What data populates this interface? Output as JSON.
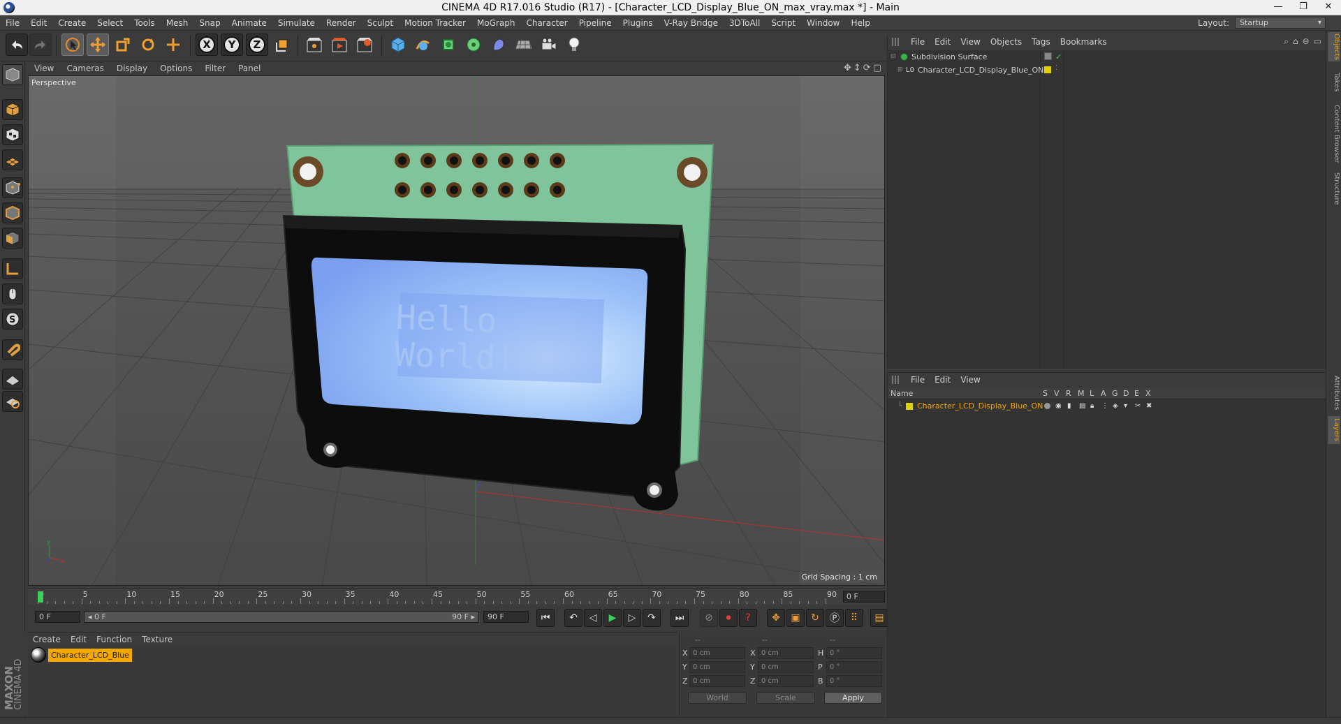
{
  "window": {
    "title": "CINEMA 4D R17.016 Studio (R17) - [Character_LCD_Display_Blue_ON_max_vray.max *] - Main",
    "controls": [
      "—",
      "❐",
      "✕"
    ]
  },
  "menubar": [
    "File",
    "Edit",
    "Create",
    "Select",
    "Tools",
    "Mesh",
    "Snap",
    "Animate",
    "Simulate",
    "Render",
    "Sculpt",
    "Motion Tracker",
    "MoGraph",
    "Character",
    "Pipeline",
    "Plugins",
    "V-Ray Bridge",
    "3DToAll",
    "Script",
    "Window",
    "Help"
  ],
  "layout": {
    "label": "Layout:",
    "value": "Startup"
  },
  "viewport": {
    "menu": [
      "View",
      "Cameras",
      "Display",
      "Options",
      "Filter",
      "Panel"
    ],
    "camera_label": "Perspective",
    "grid_spacing": "Grid Spacing : 1 cm",
    "lcd_text_line1": "Hello",
    "lcd_text_line2": "World!",
    "axis_y": "y",
    "axis_x": "x"
  },
  "timeline": {
    "ticks": [
      "0",
      "5",
      "10",
      "15",
      "20",
      "25",
      "30",
      "35",
      "40",
      "45",
      "50",
      "55",
      "60",
      "65",
      "70",
      "75",
      "80",
      "85",
      "90"
    ],
    "current_frame": "0 F",
    "start_frame": "0 F",
    "range_start": "◂ 0 F",
    "range_end": "90 F ▸",
    "end_frame": "90 F"
  },
  "material_manager": {
    "menu": [
      "Create",
      "Edit",
      "Function",
      "Texture"
    ],
    "materials": [
      "Character_LCD_Blue"
    ]
  },
  "coordinates": {
    "header": [
      "--",
      "--",
      "--"
    ],
    "rows": [
      {
        "a": "X",
        "av": "0 cm",
        "b": "X",
        "bv": "0 cm",
        "c": "H",
        "cv": "0 °"
      },
      {
        "a": "Y",
        "av": "0 cm",
        "b": "Y",
        "bv": "0 cm",
        "c": "P",
        "cv": "0 °"
      },
      {
        "a": "Z",
        "av": "0 cm",
        "b": "Z",
        "bv": "0 cm",
        "c": "B",
        "cv": "0 °"
      }
    ],
    "mode": "World",
    "scale": "Scale",
    "apply": "Apply"
  },
  "brand": {
    "line1": "MAXON",
    "line2": "CINEMA 4D"
  },
  "object_manager": {
    "menu": [
      "File",
      "Edit",
      "View",
      "Objects",
      "Tags",
      "Bookmarks"
    ],
    "objects": [
      {
        "name": "Subdivision Surface",
        "indent": 0
      },
      {
        "name": "Character_LCD_Display_Blue_ON",
        "indent": 1
      }
    ]
  },
  "layer_manager": {
    "menu": [
      "File",
      "Edit",
      "View"
    ],
    "columns": [
      "Name",
      "S",
      "V",
      "R",
      "M",
      "L",
      "A",
      "G",
      "D",
      "E",
      "X"
    ],
    "layers": [
      "Character_LCD_Display_Blue_ON"
    ]
  },
  "side_tabs": [
    "Objects",
    "Takes",
    "Content Browser",
    "Structure",
    "Attributes",
    "Layers"
  ],
  "colors": {
    "accent_orange": "#f5a800",
    "layer_yellow": "#e0d000",
    "pcb_green": "#7fc49a",
    "lcd_blue": "#8fb6f5"
  }
}
